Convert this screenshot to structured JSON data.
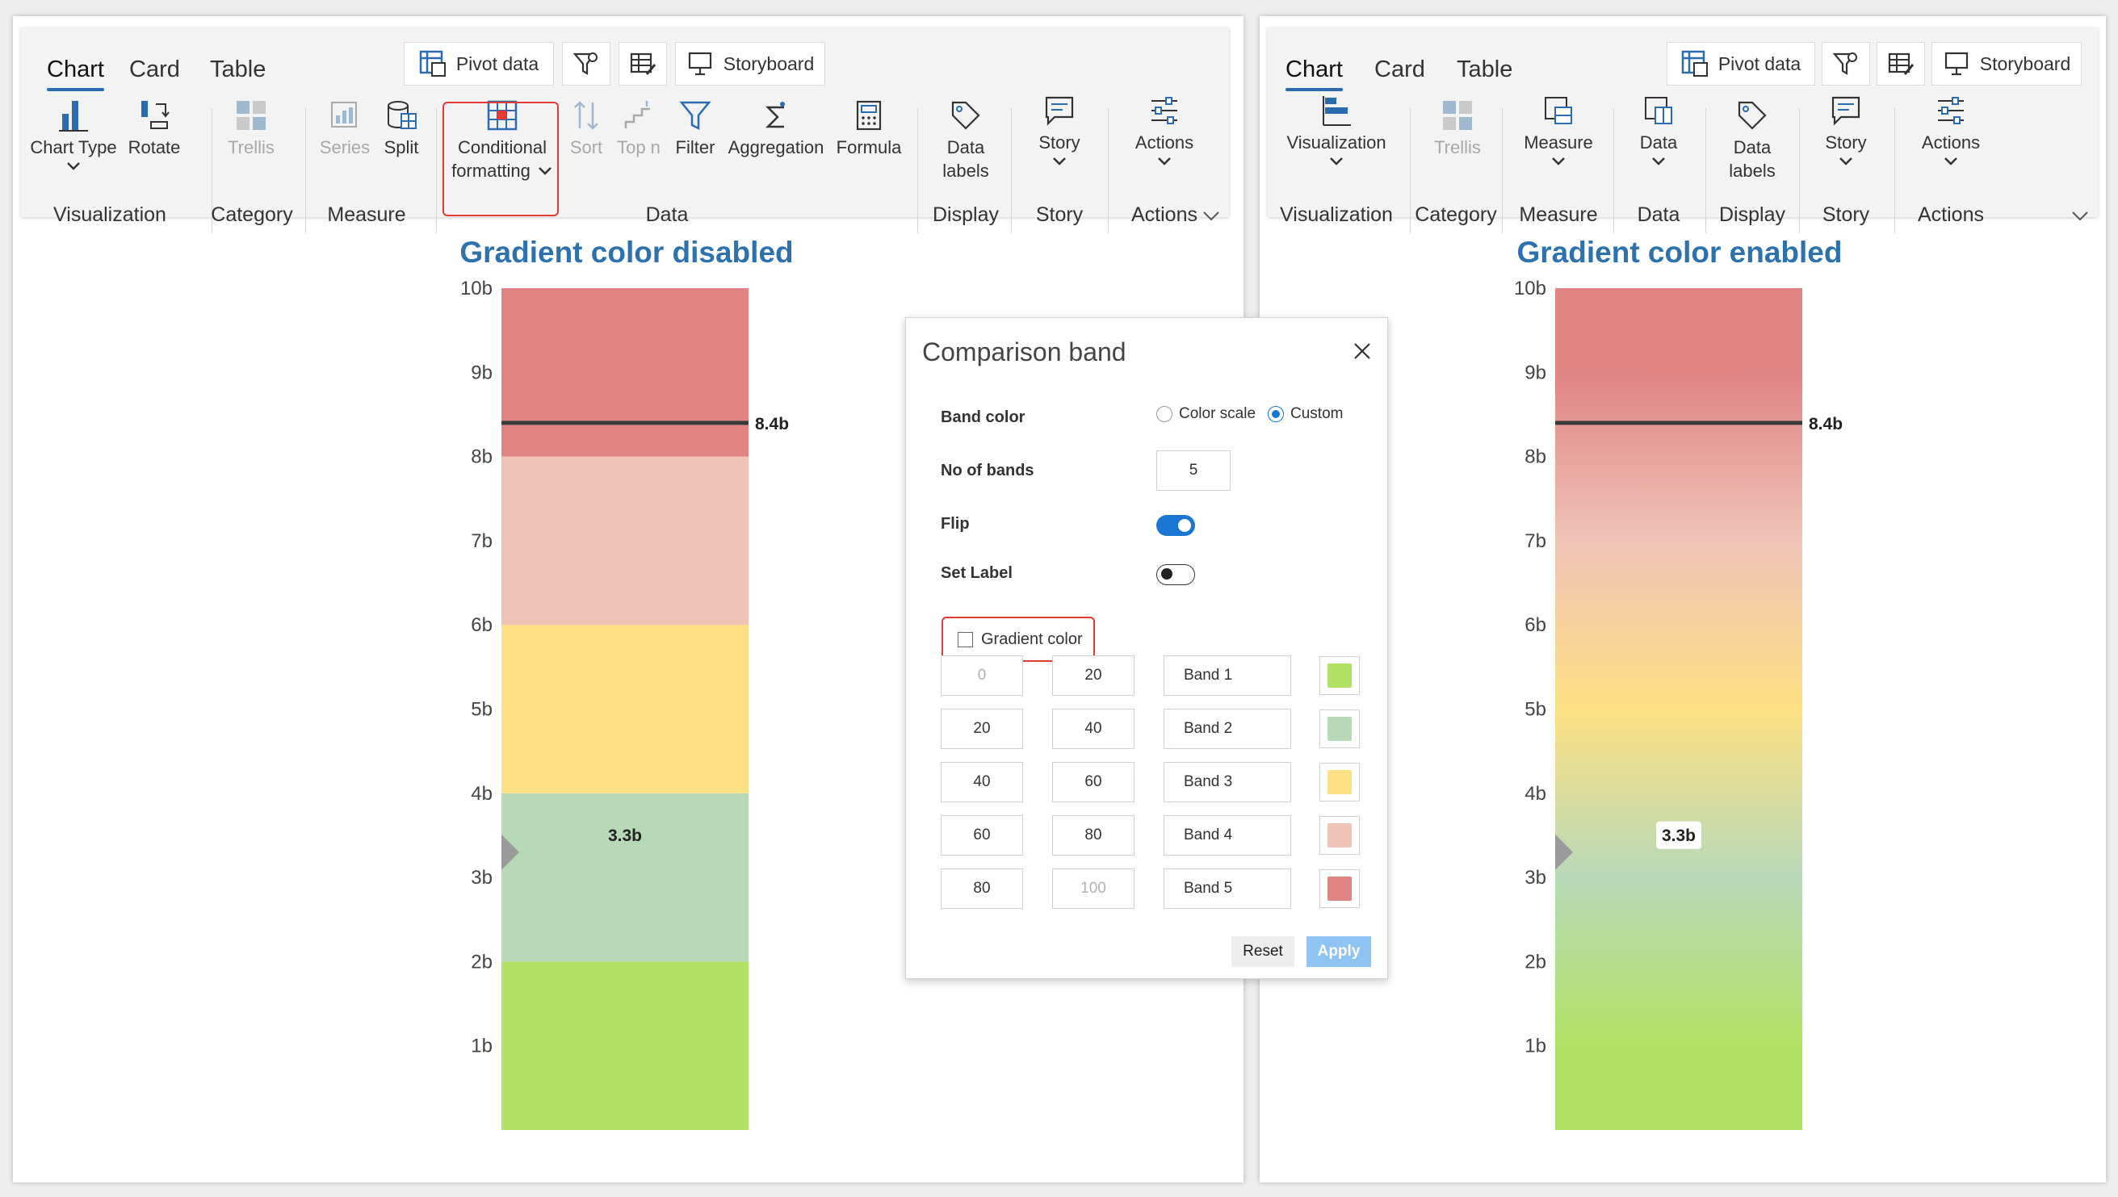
{
  "colors": {
    "accent": "#2b6cb0",
    "title": "#2e72ad",
    "highlight": "#e53935",
    "band1": "#b2e264",
    "band2": "#b8d9b8",
    "band3": "#fde083",
    "band4": "#f0c3b7",
    "band5": "#e08484",
    "marker": "#3a3a3a"
  },
  "left_panel": {
    "tabs": [
      {
        "label": "Chart",
        "active": true
      },
      {
        "label": "Card",
        "active": false
      },
      {
        "label": "Table",
        "active": false
      }
    ],
    "top_buttons": {
      "pivot": "Pivot data",
      "storyboard": "Storyboard"
    },
    "ribbon": {
      "chart_type": "Chart Type",
      "rotate": "Rotate",
      "trellis": "Trellis",
      "series": "Series",
      "split": "Split",
      "conditional_1": "Conditional",
      "conditional_2": "formatting",
      "sort": "Sort",
      "top_n": "Top n",
      "filter": "Filter",
      "aggregation": "Aggregation",
      "formula": "Formula",
      "data_labels_1": "Data",
      "data_labels_2": "labels",
      "story": "Story",
      "actions": "Actions"
    },
    "groups": {
      "visualization": "Visualization",
      "category": "Category",
      "measure": "Measure",
      "data": "Data",
      "display": "Display",
      "story": "Story",
      "actions": "Actions"
    },
    "title": "Gradient color disabled"
  },
  "right_panel": {
    "tabs": [
      {
        "label": "Chart",
        "active": true
      },
      {
        "label": "Card",
        "active": false
      },
      {
        "label": "Table",
        "active": false
      }
    ],
    "top_buttons": {
      "pivot": "Pivot data",
      "storyboard": "Storyboard"
    },
    "ribbon": {
      "visualization": "Visualization",
      "trellis": "Trellis",
      "measure": "Measure",
      "data": "Data",
      "data_labels_1": "Data",
      "data_labels_2": "labels",
      "story": "Story",
      "actions": "Actions"
    },
    "groups": {
      "visualization": "Visualization",
      "category": "Category",
      "measure": "Measure",
      "data": "Data",
      "display": "Display",
      "story": "Story",
      "actions": "Actions"
    },
    "title": "Gradient color enabled"
  },
  "chart_data": [
    {
      "type": "bar",
      "title": "Gradient color disabled",
      "ylim": [
        0,
        10
      ],
      "y_ticks": [
        "1b",
        "2b",
        "3b",
        "4b",
        "5b",
        "6b",
        "7b",
        "8b",
        "9b",
        "10b"
      ],
      "bands": [
        {
          "from": 0,
          "to": 2,
          "color": "#b2e264"
        },
        {
          "from": 2,
          "to": 4,
          "color": "#b8d9b8"
        },
        {
          "from": 4,
          "to": 6,
          "color": "#fde083"
        },
        {
          "from": 6,
          "to": 8,
          "color": "#f0c3b7"
        },
        {
          "from": 8,
          "to": 10,
          "color": "#e08484"
        }
      ],
      "gradient": false,
      "value": 3.3,
      "value_label": "3.3b",
      "target": 8.4,
      "target_label": "8.4b"
    },
    {
      "type": "bar",
      "title": "Gradient color enabled",
      "ylim": [
        0,
        10
      ],
      "y_ticks": [
        "1b",
        "2b",
        "3b",
        "4b",
        "5b",
        "6b",
        "7b",
        "8b",
        "9b",
        "10b"
      ],
      "bands": [
        {
          "from": 0,
          "to": 2,
          "color": "#b2e264"
        },
        {
          "from": 2,
          "to": 4,
          "color": "#b8d9b8"
        },
        {
          "from": 4,
          "to": 6,
          "color": "#fde083"
        },
        {
          "from": 6,
          "to": 8,
          "color": "#f0c3b7"
        },
        {
          "from": 8,
          "to": 10,
          "color": "#e08484"
        }
      ],
      "gradient": true,
      "value": 3.3,
      "value_label": "3.3b",
      "target": 8.4,
      "target_label": "8.4b"
    }
  ],
  "dialog": {
    "title": "Comparison band",
    "band_color_label": "Band color",
    "color_scale_label": "Color scale",
    "custom_label": "Custom",
    "selected": "Custom",
    "no_of_bands_label": "No of bands",
    "no_of_bands_value": "5",
    "flip_label": "Flip",
    "flip": true,
    "set_label_label": "Set Label",
    "set_label": false,
    "gradient_label": "Gradient color",
    "gradient_checked": false,
    "bands": [
      {
        "from": "0",
        "to": "20",
        "name": "Band 1",
        "color": "#b2e264"
      },
      {
        "from": "20",
        "to": "40",
        "name": "Band 2",
        "color": "#b8d9b8"
      },
      {
        "from": "40",
        "to": "60",
        "name": "Band 3",
        "color": "#fde083"
      },
      {
        "from": "60",
        "to": "80",
        "name": "Band 4",
        "color": "#f0c3b7"
      },
      {
        "from": "80",
        "to": "100",
        "name": "Band 5",
        "color": "#e08484"
      }
    ],
    "reset_label": "Reset",
    "apply_label": "Apply"
  }
}
